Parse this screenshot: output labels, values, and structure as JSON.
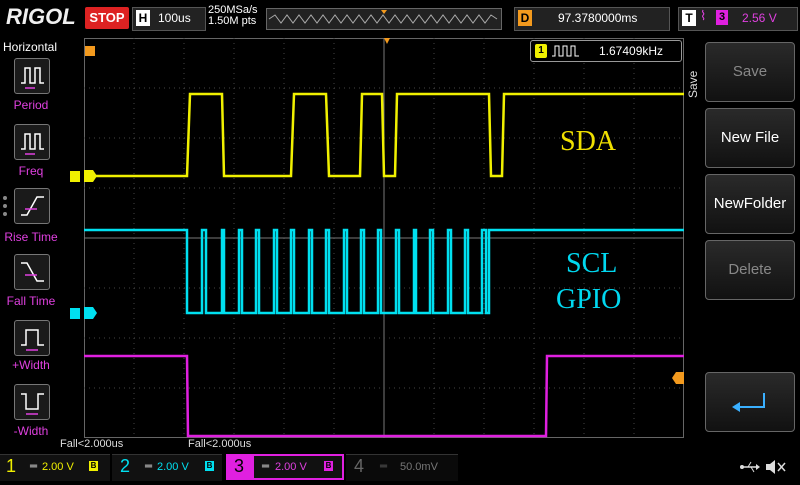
{
  "brand": "RIGOL",
  "run_state": "STOP",
  "horizontal": {
    "label": "H",
    "timebase": "100us",
    "sample_rate": "250MSa/s",
    "points": "1.50M pts"
  },
  "delay": {
    "label": "D",
    "value": "97.3780000ms"
  },
  "trigger": {
    "label": "T",
    "source": "3",
    "level": "2.56 V",
    "edge": "falling"
  },
  "left_menu": {
    "title": "Horizontal",
    "items": [
      {
        "label": "Period",
        "icon": "period-icon"
      },
      {
        "label": "Freq",
        "icon": "freq-icon"
      },
      {
        "label": "Rise Time",
        "icon": "rise-time-icon"
      },
      {
        "label": "Fall Time",
        "icon": "fall-time-icon"
      },
      {
        "label": "+Width",
        "icon": "pos-width-icon"
      },
      {
        "label": "-Width",
        "icon": "neg-width-icon"
      }
    ]
  },
  "measurement": {
    "channel": "1",
    "value": "1.67409kHz"
  },
  "annotations": {
    "sda": "SDA",
    "scl": "SCL",
    "gpio": "GPIO"
  },
  "right_menu": {
    "title": "Save",
    "buttons": [
      {
        "label": "Save",
        "enabled": false
      },
      {
        "label": "New File",
        "enabled": true
      },
      {
        "label": "NewFolder",
        "enabled": true
      },
      {
        "label": "Delete",
        "enabled": false
      },
      {
        "label": "",
        "icon": "enter-icon",
        "enabled": true
      }
    ]
  },
  "fall_labels": [
    "Fall<2.000us",
    "Fall<2.000us"
  ],
  "markers": {
    "ch1": "1",
    "ch2": "2",
    "trigger_pos": "T"
  },
  "channels": [
    {
      "num": "1",
      "scale": "2.00 V",
      "color": "#f0f000"
    },
    {
      "num": "2",
      "scale": "2.00 V",
      "color": "#00e0f0"
    },
    {
      "num": "3",
      "scale": "2.00 V",
      "color": "#e020e0"
    },
    {
      "num": "4",
      "scale": "50.0mV",
      "color": "#555555"
    }
  ],
  "colors": {
    "ch1": "#f0f000",
    "ch2": "#00e0f0",
    "ch3": "#e020e0",
    "trigger": "#f39a1e"
  }
}
